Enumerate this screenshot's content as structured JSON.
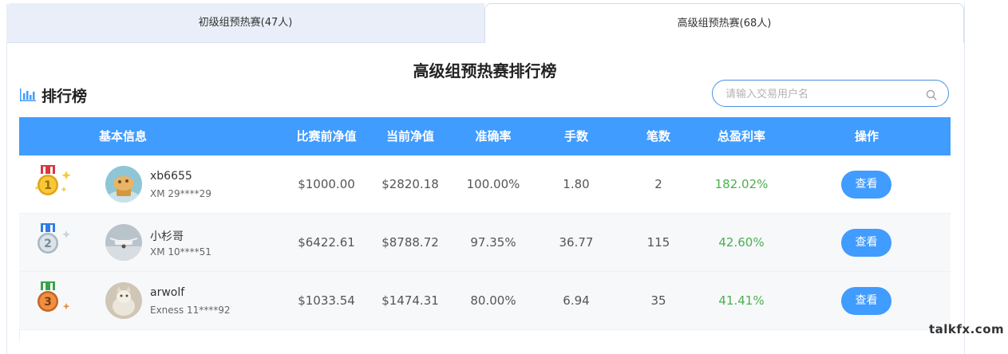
{
  "tabs": [
    {
      "label": "初级组预热赛(47人)",
      "active": false
    },
    {
      "label": "高级组预热赛(68人)",
      "active": true
    }
  ],
  "title": "高级组预热赛排行榜",
  "ranking_label": "排行榜",
  "search": {
    "placeholder": "请输入交易用户名",
    "value": ""
  },
  "columns": [
    "基本信息",
    "比赛前净值",
    "当前净值",
    "准确率",
    "手数",
    "笔数",
    "总盈利率",
    "操作"
  ],
  "rows": [
    {
      "rank": "1",
      "medal_color": "#f2b824",
      "ribbon_color": "#d9363e",
      "name": "xb6655",
      "account": "XM 29****29",
      "before": "$1000.00",
      "current": "$2820.18",
      "accuracy": "100.00%",
      "lots": "1.80",
      "trades": "2",
      "profit": "182.02%",
      "action": "查看"
    },
    {
      "rank": "2",
      "medal_color": "#c8d3dc",
      "ribbon_color": "#2f7de1",
      "name": "小杉哥",
      "account": "XM 10****51",
      "before": "$6422.61",
      "current": "$8788.72",
      "accuracy": "97.35%",
      "lots": "36.77",
      "trades": "115",
      "profit": "42.60%",
      "action": "查看"
    },
    {
      "rank": "3",
      "medal_color": "#e8843a",
      "ribbon_color": "#3aa34a",
      "name": "arwolf",
      "account": "Exness 11****92",
      "before": "$1033.54",
      "current": "$1474.31",
      "accuracy": "80.00%",
      "lots": "6.94",
      "trades": "35",
      "profit": "41.41%",
      "action": "查看"
    }
  ],
  "watermark": "talkfx.com",
  "colors": {
    "header_bg": "#409cff",
    "button": "#409cff",
    "profit": "#4caf50",
    "tab_inactive": "#e9eef8"
  }
}
